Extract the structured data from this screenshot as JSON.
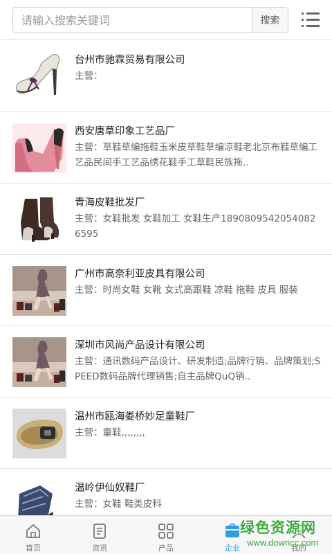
{
  "search": {
    "placeholder": "请输入搜索关键词",
    "button_label": "搜索"
  },
  "companies": [
    {
      "name": "台州市驰霖贸易有限公司",
      "desc": "主营："
    },
    {
      "name": "西安唐草印象工艺品厂",
      "desc": "主营：草鞋草编拖鞋玉米皮草鞋草编凉鞋老北京布鞋草编工艺品民间手工艺品绣花鞋手工草鞋民族拖.."
    },
    {
      "name": "青海皮鞋批发厂",
      "desc": "主营：女鞋批发 女鞋加工 女鞋生产18908095420540826595"
    },
    {
      "name": "广州市高奈利亚皮具有限公司",
      "desc": "主营：时尚女鞋 女靴 女式高跟鞋 凉鞋 拖鞋 皮具 服装"
    },
    {
      "name": "深圳市风尚产品设计有限公司",
      "desc": "主营：通讯数码产品设计、研发制造;品牌行销、品牌策划;SPEED数码品牌代理销售;自主品牌QuQ销.."
    },
    {
      "name": "温州市瓯海娄桥妙足童鞋厂",
      "desc": "主营：童鞋,,,,,,,,"
    },
    {
      "name": "温岭伊仙奴鞋厂",
      "desc": "主营：女鞋 鞋类皮料"
    }
  ],
  "tabs": [
    {
      "label": "首页",
      "icon": "home-icon",
      "active": false
    },
    {
      "label": "资讯",
      "icon": "news-icon",
      "active": false
    },
    {
      "label": "产品",
      "icon": "grid-icon",
      "active": false
    },
    {
      "label": "企业",
      "icon": "company-icon",
      "active": true
    },
    {
      "label": "我的",
      "icon": "user-icon",
      "active": false
    }
  ],
  "watermark": {
    "title": "绿色资源网",
    "url": "www.downcc.com"
  },
  "colors": {
    "accent": "#2f9be0",
    "watermark": "#3ea941",
    "divider": "#e0e0e0"
  }
}
